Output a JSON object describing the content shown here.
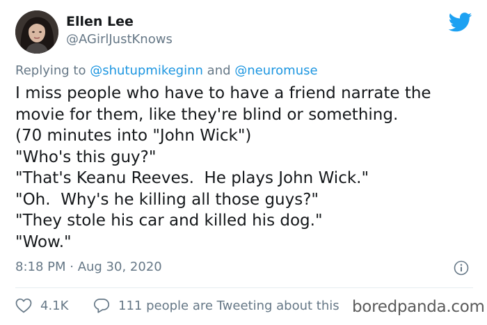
{
  "author": {
    "display_name": "Ellen Lee",
    "handle": "@AGirlJustKnows"
  },
  "reply": {
    "prefix": "Replying to ",
    "mention_1": "@shutupmikeginn",
    "joiner": " and ",
    "mention_2": "@neuromuse"
  },
  "tweet": {
    "lines": [
      "I miss people who have to have a friend narrate the",
      "movie for them, like they're blind or something.",
      "(70 minutes into \"John Wick\")",
      "\"Who's this guy?\"",
      "\"That's Keanu Reeves.  He plays John Wick.\"",
      "\"Oh.  Why's he killing all those guys?\"",
      "\"They stole his car and killed his dog.\"",
      "\"Wow.\""
    ]
  },
  "meta": {
    "timestamp": "8:18 PM · Aug 30, 2020"
  },
  "actions": {
    "likes": "4.1K",
    "tweeting": "111 people are Tweeting about this"
  },
  "watermark": "boredpanda.com",
  "colors": {
    "twitter_blue": "#1da1f2",
    "mention_blue": "#1b95e0",
    "secondary_text": "#657786",
    "divider": "#e6ecf0"
  },
  "icons": [
    "twitter-bird-icon",
    "info-icon",
    "heart-icon",
    "reply-bubble-icon"
  ]
}
